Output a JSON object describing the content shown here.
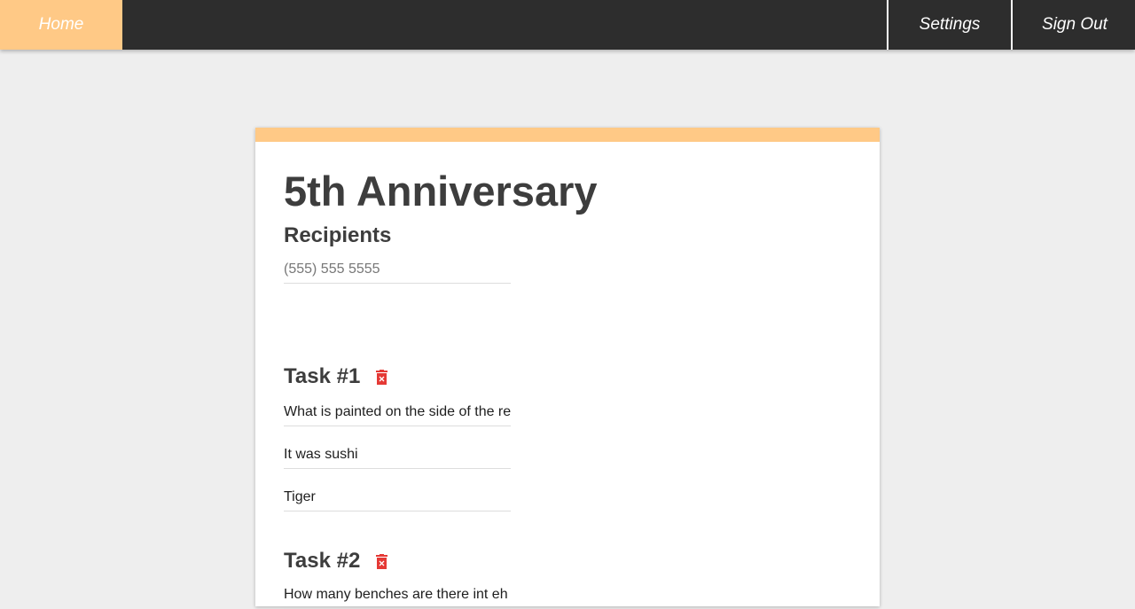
{
  "nav": {
    "home_label": "Home",
    "settings_label": "Settings",
    "signout_label": "Sign Out"
  },
  "colors": {
    "accent": "#ffc986",
    "navbar": "#2d2d2d",
    "delete": "#e53935"
  },
  "event": {
    "title": "5th Anniversary",
    "recipients_heading": "Recipients",
    "recipients_placeholder": "(555) 555 5555"
  },
  "tasks": [
    {
      "heading": "Task #1",
      "delete_icon": "trash-icon",
      "question": "What is painted on the side of the re",
      "hint": "It was sushi",
      "answer": "Tiger"
    },
    {
      "heading": "Task #2",
      "delete_icon": "trash-icon",
      "question": "How many benches are there int eh s"
    }
  ]
}
